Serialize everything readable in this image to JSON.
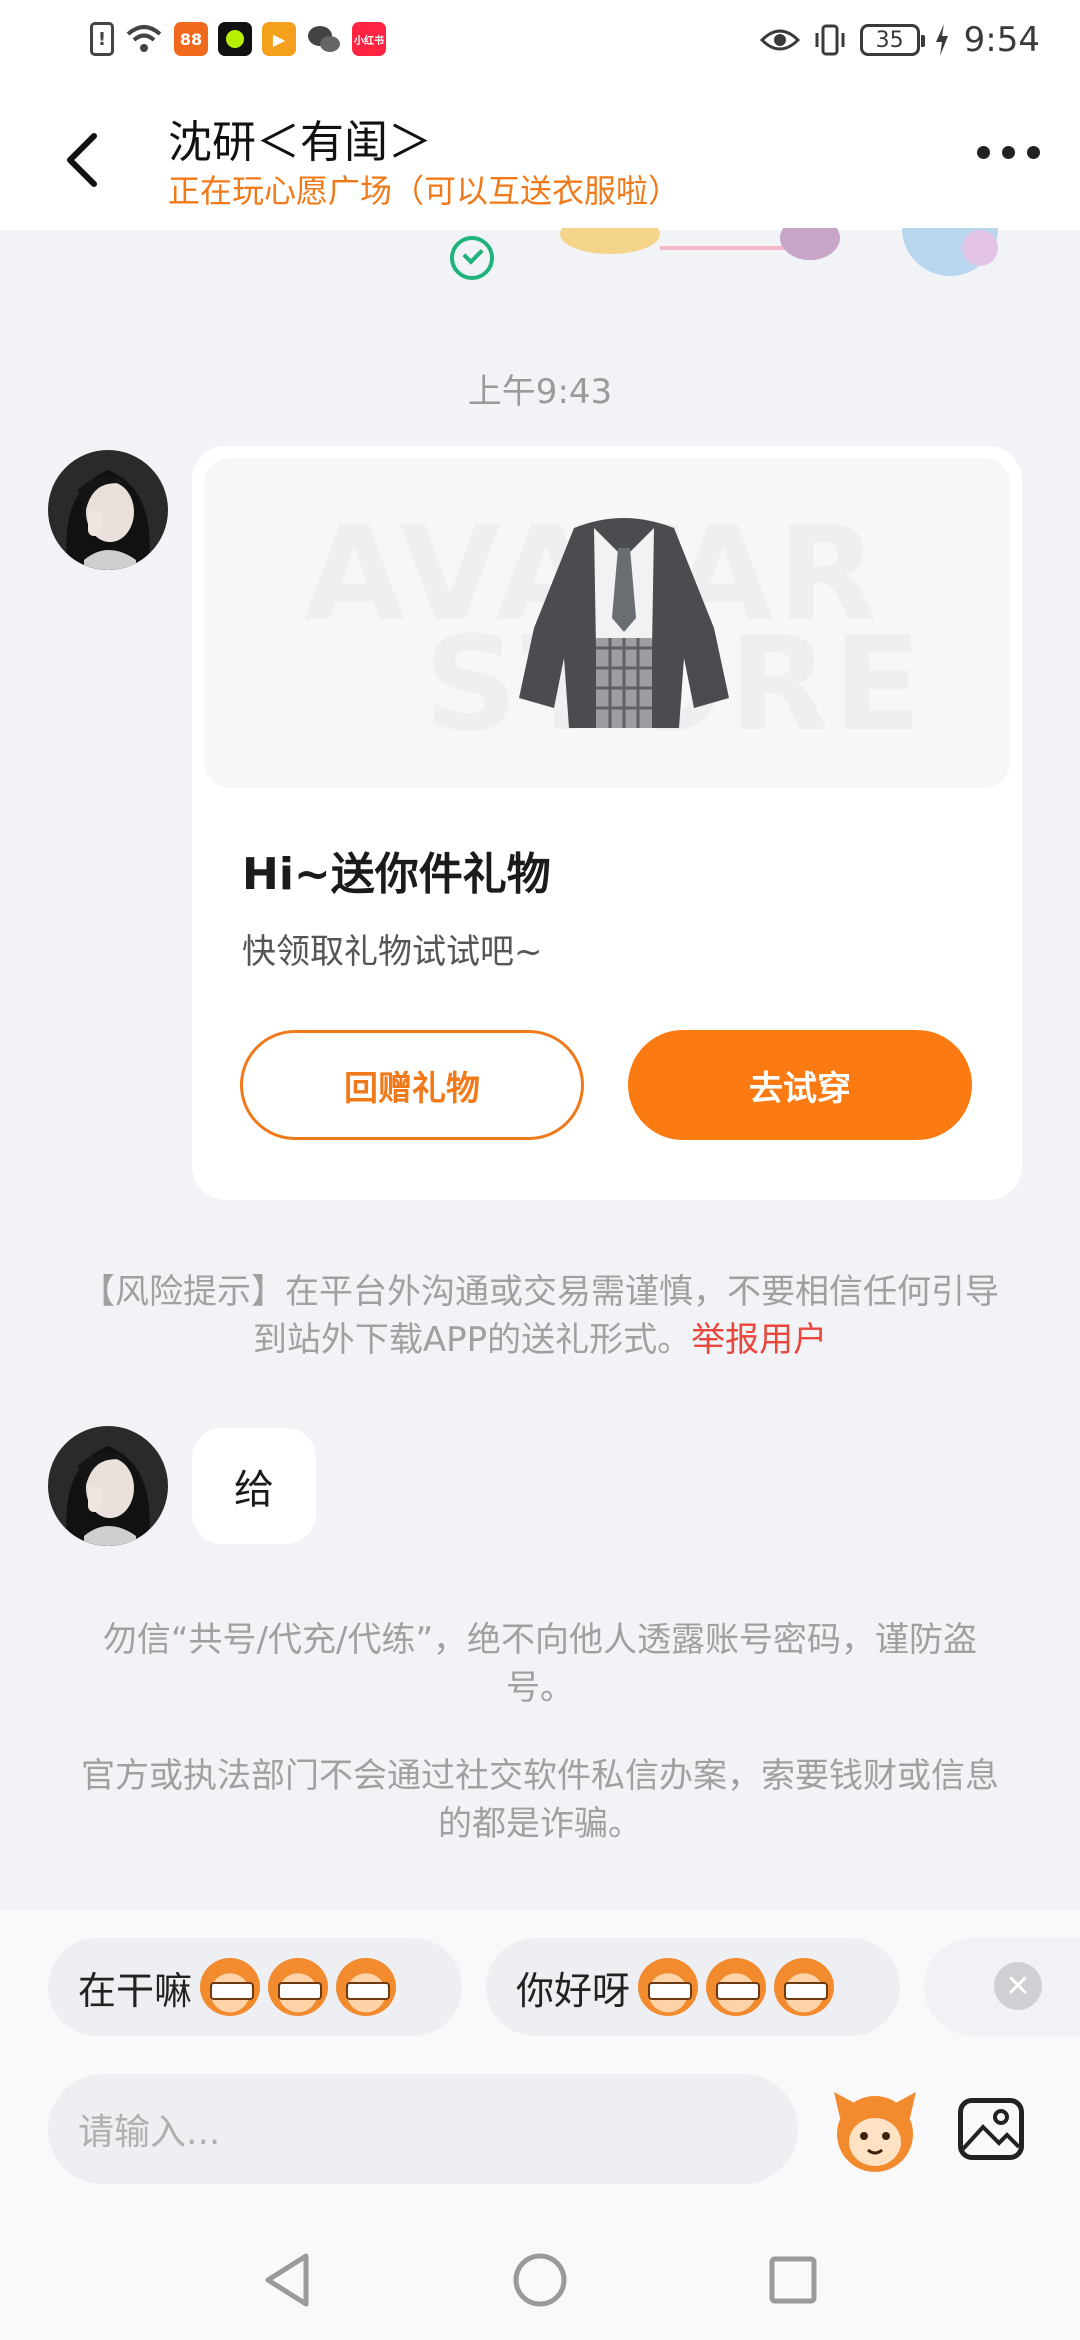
{
  "status_bar": {
    "time": "9:54",
    "battery": "35",
    "app_icons": [
      "alert-icon",
      "wifi-icon",
      "app-icon-1",
      "app-icon-2",
      "app-icon-3",
      "wechat-icon",
      "xiaohongshu-icon"
    ],
    "xhs_label": "小红书"
  },
  "header": {
    "title": "沈研＜有闺＞",
    "subtitle": "正在玩心愿广场（可以互送衣服啦）"
  },
  "chat": {
    "timestamp": "上午9:43",
    "gift_card": {
      "watermark_1": "AVATAR",
      "watermark_2": "STORE",
      "title": "Hi~送你件礼物",
      "description": "快领取礼物试试吧~",
      "return_gift_label": "回赠礼物",
      "try_on_label": "去试穿"
    },
    "risk_notice": {
      "text": "【风险提示】在平台外沟通或交易需谨慎，不要相信任何引导到站外下载APP的送礼形式。",
      "report_link": "举报用户"
    },
    "message_text": "给",
    "safety_notice_1": "勿信“共号/代充/代练”，绝不向他人透露账号密码，谨防盗号。",
    "safety_notice_2": "官方或执法部门不会通过社交软件私信办案，索要钱财或信息的都是诈骗。"
  },
  "quick_replies": [
    {
      "label": "在干嘛"
    },
    {
      "label": "你好呀"
    }
  ],
  "composer": {
    "placeholder": "请输入..."
  },
  "colors": {
    "accent": "#fb7a12",
    "report": "#e9463c",
    "ok_green": "#1fb27a"
  }
}
